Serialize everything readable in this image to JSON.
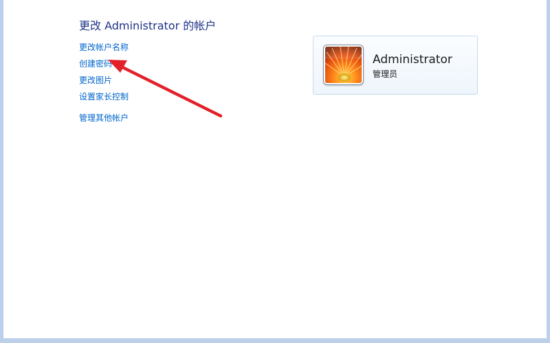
{
  "page": {
    "title": "更改 Administrator 的帐户"
  },
  "links": {
    "change_name": "更改帐户名称",
    "create_password": "创建密码",
    "change_picture": "更改图片",
    "parental_controls": "设置家长控制",
    "manage_other": "管理其他帐户"
  },
  "account": {
    "name": "Administrator",
    "role": "管理员",
    "avatar_icon": "flower-avatar-icon"
  },
  "colors": {
    "title": "#1e3287",
    "link": "#0066cc",
    "arrow": "#e2212b"
  }
}
